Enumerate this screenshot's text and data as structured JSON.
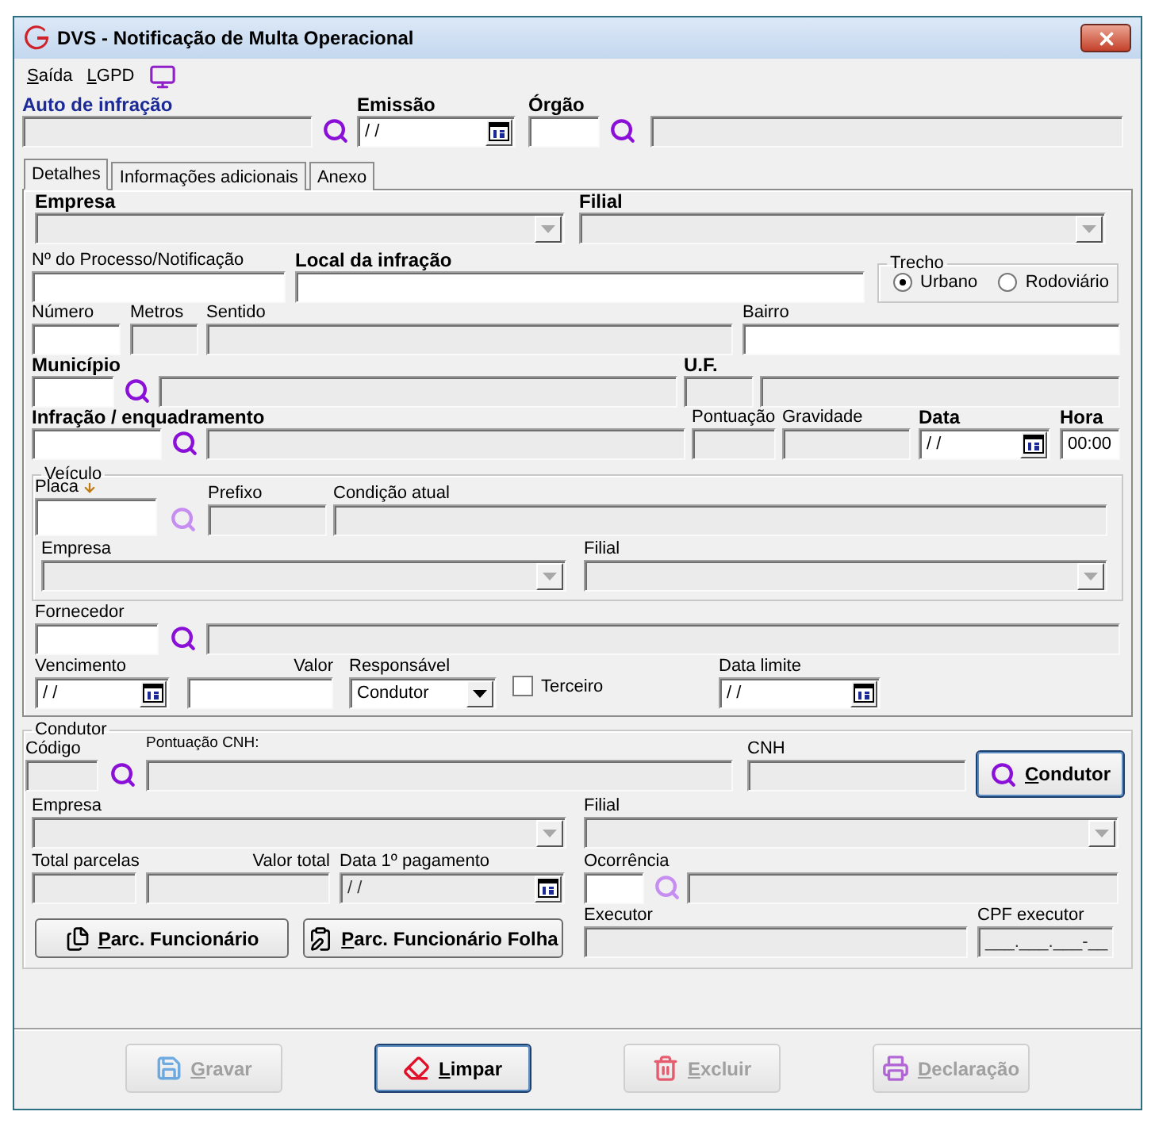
{
  "window": {
    "title": "DVS - Notificação de Multa Operacional"
  },
  "menu": [
    {
      "label": "Saída"
    },
    {
      "label": "LGPD"
    }
  ],
  "header": {
    "auto_infracao": {
      "label": "Auto de infração",
      "required": true,
      "disabled": true,
      "search_disabled": false
    },
    "emissao": {
      "label": "Emissão",
      "required": true,
      "disabled": false,
      "value": "/ /"
    },
    "orgao": {
      "label": "Órgão",
      "required": true,
      "disabled": false,
      "search_disabled": false
    },
    "orgao_descricao": {
      "disabled": true
    }
  },
  "tabs": [
    {
      "label": "Detalhes",
      "selected": true
    },
    {
      "label": "Informações adicionais",
      "selected": false
    },
    {
      "label": "Anexo",
      "selected": false
    }
  ],
  "detalhes": {
    "empresa": {
      "label": "Empresa",
      "required": true,
      "disabled": true
    },
    "filial": {
      "label": "Filial",
      "required": true,
      "disabled": true
    },
    "processo": {
      "label": "Nº do Processo/Notificação",
      "required": false,
      "disabled": false
    },
    "local": {
      "label": "Local da infração",
      "required": true,
      "disabled": false
    },
    "trecho": {
      "title": "Trecho",
      "options": [
        {
          "label": "Urbano",
          "selected": true
        },
        {
          "label": "Rodoviário",
          "selected": false
        }
      ]
    },
    "numero": {
      "label": "Número",
      "required": false,
      "disabled": false
    },
    "metros": {
      "label": "Metros",
      "required": false,
      "disabled": true
    },
    "sentido": {
      "label": "Sentido",
      "required": false,
      "disabled": true
    },
    "bairro": {
      "label": "Bairro",
      "required": false,
      "disabled": false
    },
    "municipio": {
      "label": "Município",
      "required": true,
      "disabled": false,
      "search_disabled": false
    },
    "municipio_descricao": {
      "disabled": true
    },
    "uf": {
      "label": "U.F.",
      "required": true,
      "disabled": true
    },
    "uf_descricao": {
      "disabled": true
    },
    "infracao": {
      "label": "Infração / enquadramento",
      "required": true,
      "disabled": false,
      "search_disabled": false
    },
    "infracao_descricao": {
      "disabled": true
    },
    "pontuacao": {
      "label": "Pontuação",
      "required": false,
      "disabled": true
    },
    "gravidade": {
      "label": "Gravidade",
      "required": false,
      "disabled": true
    },
    "data": {
      "label": "Data",
      "required": true,
      "disabled": false,
      "value": "/ /"
    },
    "hora": {
      "label": "Hora",
      "required": true,
      "disabled": false,
      "value": "00:00"
    },
    "veiculo": {
      "title": "Veículo",
      "placa": {
        "label": "Placa",
        "required": false,
        "disabled": false,
        "search_disabled": true
      },
      "prefixo": {
        "label": "Prefixo",
        "required": false,
        "disabled": true
      },
      "condicao": {
        "label": "Condição atual",
        "required": false,
        "disabled": true
      },
      "empresa": {
        "label": "Empresa",
        "required": false,
        "disabled": true
      },
      "filial": {
        "label": "Filial",
        "required": false,
        "disabled": true
      }
    },
    "fornecedor": {
      "label": "Fornecedor",
      "required": false,
      "disabled": false,
      "search_disabled": false
    },
    "fornecedor_descricao": {
      "disabled": true
    },
    "vencimento": {
      "label": "Vencimento",
      "required": false,
      "disabled": false,
      "value": "/ /"
    },
    "valor": {
      "label": "Valor",
      "required": false,
      "disabled": false
    },
    "responsavel": {
      "label": "Responsável",
      "required": false,
      "disabled": false,
      "value": "Condutor"
    },
    "terceiro": {
      "label": "Terceiro",
      "checked": false
    },
    "data_limite": {
      "label": "Data limite",
      "required": false,
      "disabled": false,
      "value": "/ /"
    }
  },
  "condutor": {
    "title": "Condutor",
    "codigo": {
      "label": "Código",
      "required": false,
      "disabled": true,
      "search_disabled": false
    },
    "pontuacao_cnh": {
      "label": "Pontuação CNH:",
      "required": false,
      "disabled": true
    },
    "cnh": {
      "label": "CNH",
      "required": false,
      "disabled": true
    },
    "button": {
      "label": "Condutor",
      "focused": true
    },
    "empresa": {
      "label": "Empresa",
      "required": false,
      "disabled": true
    },
    "filial": {
      "label": "Filial",
      "required": false,
      "disabled": true
    },
    "total_parcelas": {
      "label": "Total parcelas",
      "required": false,
      "disabled": true
    },
    "valor_total": {
      "label": "Valor total",
      "required": false,
      "disabled": true
    },
    "data_pagamento": {
      "label": "Data 1º pagamento",
      "required": false,
      "disabled": true,
      "value": "/ /"
    },
    "ocorrencia": {
      "label": "Ocorrência",
      "required": false,
      "disabled": false,
      "search_disabled": true
    },
    "ocorrencia_descricao": {
      "disabled": true
    },
    "parc_buttons": [
      {
        "label": "Parc. Funcionário",
        "focused": false
      },
      {
        "label": "Parc. Funcionário Folha",
        "focused": false
      }
    ],
    "executor": {
      "label": "Executor",
      "required": false,
      "disabled": true
    },
    "cpf_executor": {
      "label": "CPF executor",
      "required": false,
      "disabled": true,
      "value": "___.___.___-__"
    }
  },
  "actions": [
    {
      "label": "Gravar",
      "disabled": true,
      "focused": false
    },
    {
      "label": "Limpar",
      "disabled": false,
      "focused": true
    },
    {
      "label": "Excluir",
      "disabled": true,
      "focused": false
    },
    {
      "label": "Declaração",
      "disabled": true,
      "focused": false
    }
  ]
}
